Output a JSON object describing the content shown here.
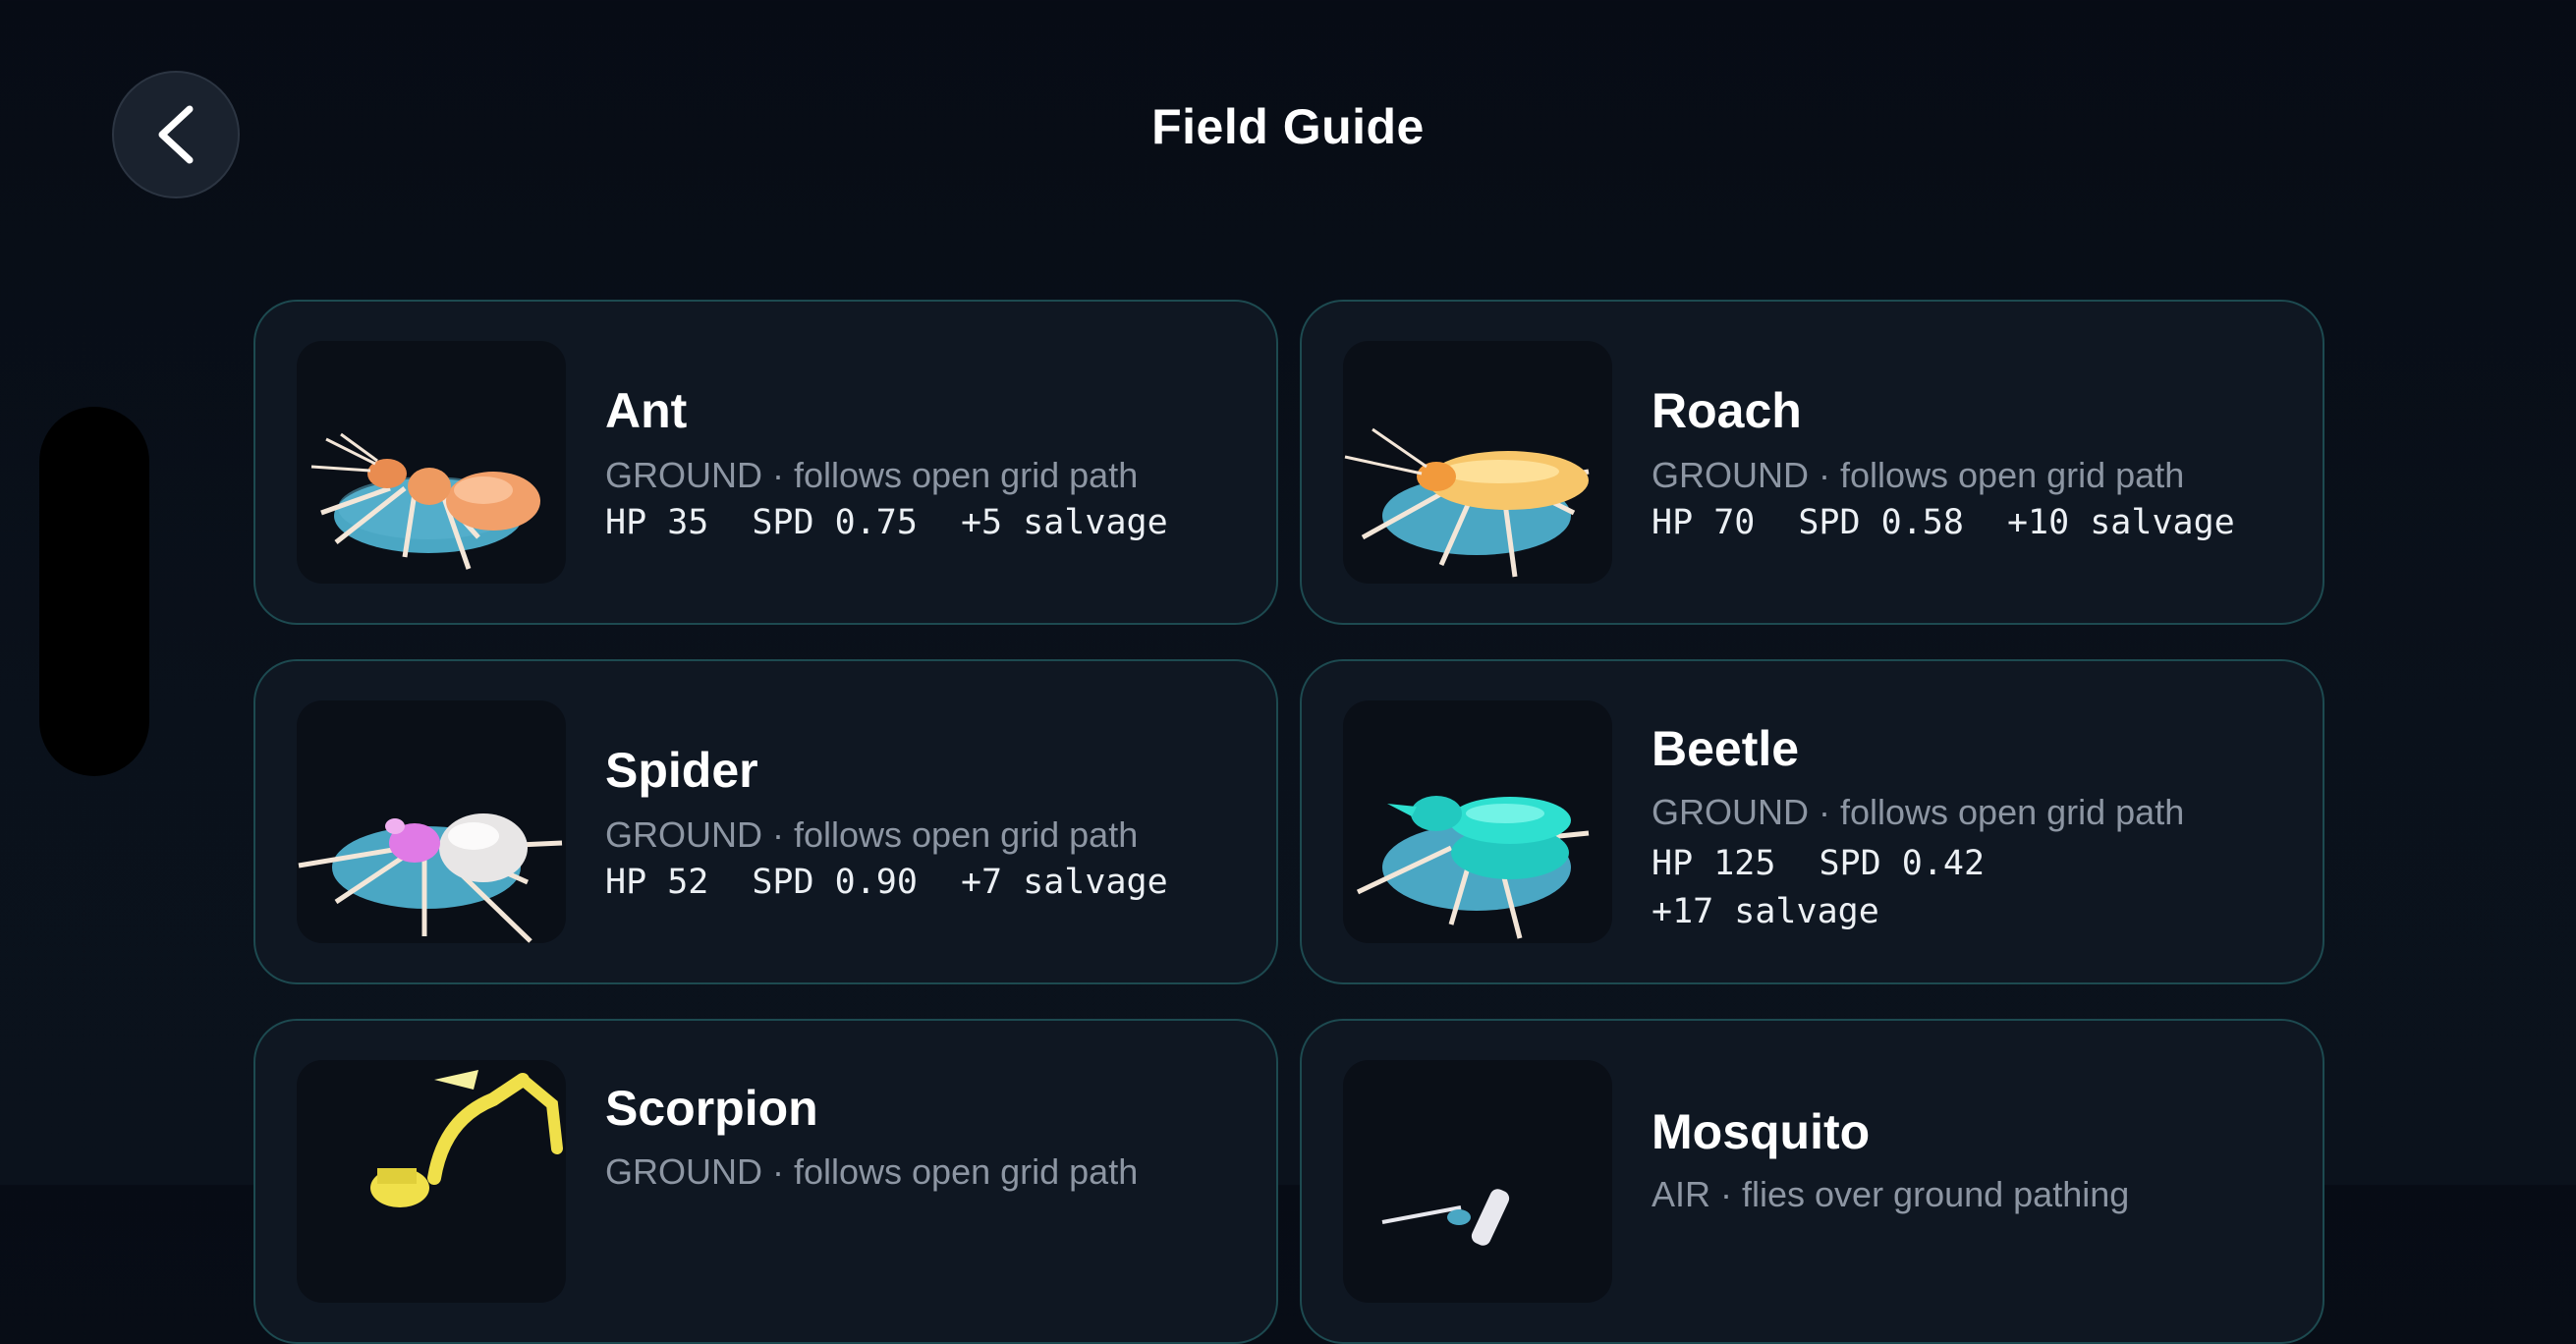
{
  "header": {
    "title": "Field Guide",
    "back_icon": "chevron-left-icon"
  },
  "creatures": [
    {
      "name": "Ant",
      "type": "GROUND · follows open grid path",
      "hp": "HP 35",
      "spd": "SPD 0.75",
      "salvage": "+5 salvage",
      "colors": {
        "body": "#f2a06a",
        "head": "#e98c50"
      }
    },
    {
      "name": "Roach",
      "type": "GROUND · follows open grid path",
      "hp": "HP 70",
      "spd": "SPD 0.58",
      "salvage": "+10 salvage",
      "colors": {
        "body": "#f7c66a",
        "head": "#f29a3c"
      }
    },
    {
      "name": "Spider",
      "type": "GROUND · follows open grid path",
      "hp": "HP 52",
      "spd": "SPD 0.90",
      "salvage": "+7 salvage",
      "colors": {
        "body": "#e8e6e6",
        "head": "#e07ae6"
      }
    },
    {
      "name": "Beetle",
      "type": "GROUND · follows open grid path",
      "hp": "HP 125",
      "spd": "SPD 0.42",
      "salvage": "+17 salvage",
      "colors": {
        "body": "#2ee0d0",
        "head": "#22c9c0"
      }
    },
    {
      "name": "Scorpion",
      "type": "GROUND · follows open grid path",
      "colors": {
        "body": "#f0e04a"
      }
    },
    {
      "name": "Mosquito",
      "type": "AIR · flies over ground pathing",
      "colors": {
        "body": "#e8e8ee"
      }
    }
  ],
  "colors": {
    "card_border": "#1d4a50",
    "card_bg": "#0f1722",
    "disc": "#4aa7c4"
  }
}
